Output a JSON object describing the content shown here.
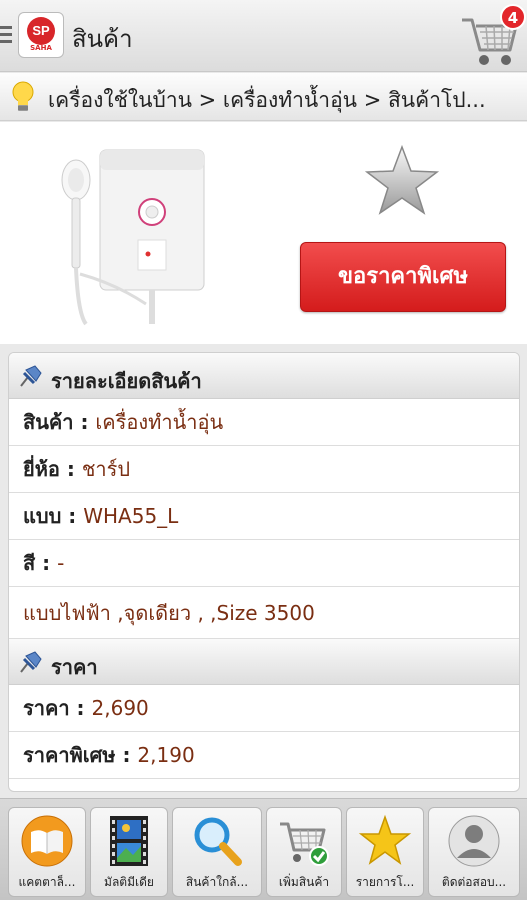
{
  "header": {
    "logo_text": "SP",
    "logo_sub": "SAHA",
    "title": "สินค้า",
    "cart_count": "4"
  },
  "breadcrumb": {
    "text": "เครื่องใช้ในบ้าน > เครื่องทำน้ำอุ่น > สินค้าโป..."
  },
  "product": {
    "special_price_button": "ขอราคาพิเศษ"
  },
  "details": {
    "section_title": "รายละเอียดสินค้า",
    "rows": [
      {
        "label": "สินค้า : ",
        "value": "เครื่องทำน้ำอุ่น"
      },
      {
        "label": "ยี่ห้อ : ",
        "value": "ชาร์ป"
      },
      {
        "label": "แบบ : ",
        "value": "WHA55_L"
      },
      {
        "label": "สี : ",
        "value": "-"
      }
    ],
    "description": " แบบไฟฟ้า ,จุดเดียว , ,Size 3500"
  },
  "price": {
    "section_title": "ราคา",
    "rows": [
      {
        "label": "ราคา : ",
        "value": "2,690"
      },
      {
        "label": "ราคาพิเศษ : ",
        "value": "2,190"
      }
    ]
  },
  "bottom_nav": {
    "items": [
      {
        "label": "แคตตาล็...",
        "icon": "book-icon"
      },
      {
        "label": "มัลติมีเดีย",
        "icon": "film-icon"
      },
      {
        "label": "สินค้าใกล้...",
        "icon": "magnifier-icon"
      },
      {
        "label": "เพิ่มสินค้า",
        "icon": "cart-add-icon"
      },
      {
        "label": "รายการโ...",
        "icon": "star-icon"
      },
      {
        "label": "ติดต่อสอบ...",
        "icon": "person-icon"
      }
    ]
  }
}
